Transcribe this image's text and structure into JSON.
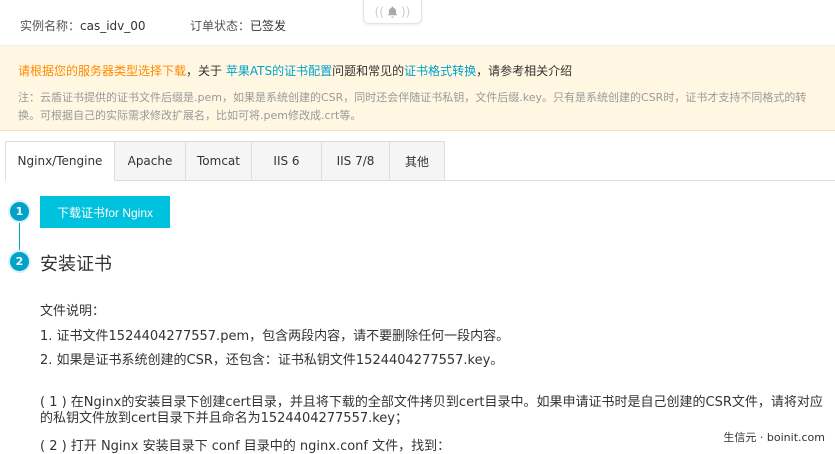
{
  "header": {
    "instance_label": "实例名称：",
    "instance_value": "cas_idv_00",
    "order_label": "订单状态：",
    "order_value": "已签发"
  },
  "notifier": {
    "icon": "bell-icon"
  },
  "notice": {
    "line1": {
      "part1": "请根据您的服务器类型选择下载",
      "part2": "，关于 ",
      "link1": "苹果ATS的证书配置",
      "part3": "问题和常见的",
      "link2": "证书格式转换",
      "part4": "，请参考相关介绍"
    },
    "line2": "注：云盾证书提供的证书文件后缀是.pem，如果是系统创建的CSR，同时还会伴随证书私钥，文件后缀.key。只有是系统创建的CSR时，证书才支持不同格式的转换。可根据自己的实际需求修改扩展名，比如可将.pem修改成.crt等。"
  },
  "tabs": [
    {
      "label": "Nginx/Tengine",
      "active": true
    },
    {
      "label": "Apache"
    },
    {
      "label": "Tomcat"
    },
    {
      "label": "IIS 6"
    },
    {
      "label": "IIS 7/8"
    },
    {
      "label": "其他"
    }
  ],
  "steps": {
    "step1_number": "1",
    "download_button": "下载证书for Nginx",
    "step2_number": "2",
    "step2_title": "安装证书"
  },
  "content": {
    "file_desc": "文件说明：",
    "item1": "1. 证书文件1524404277557.pem，包含两段内容，请不要删除任何一段内容。",
    "item2": "2. 如果是证书系统创建的CSR，还包含：证书私钥文件1524404277557.key。",
    "para1": "( 1 ) 在Nginx的安装目录下创建cert目录，并且将下载的全部文件拷贝到cert目录中。如果申请证书时是自己创建的CSR文件，请将对应的私钥文件放到cert目录下并且命名为1524404277557.key；",
    "para2": "( 2 ) 打开 Nginx 安装目录下 conf 目录中的 nginx.conf 文件，找到："
  },
  "watermark": "生信元 · boinit.com",
  "colors": {
    "accent": "#00a2ca",
    "button": "#00c1de",
    "notice_bg": "#fff7e2",
    "orange": "#ff8a00"
  }
}
